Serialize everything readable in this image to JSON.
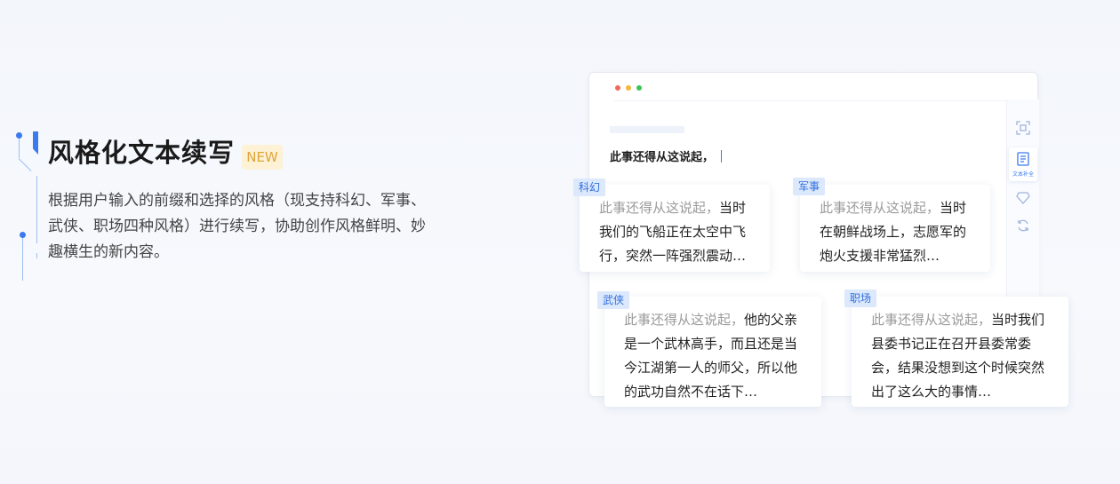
{
  "feature": {
    "title": "风格化文本续写",
    "badge": "NEW",
    "description": "根据用户输入的前缀和选择的风格（现支持科幻、军事、武侠、职场四种风格）进行续写，协助创作风格鲜明、妙趣横生的新内容。"
  },
  "colors": {
    "accent": "#3a7af0",
    "badge_bg": "#fdf1d6",
    "badge_text": "#e0a53a",
    "tag_bg": "#dce8fb"
  },
  "editor": {
    "prompt": "此事还得从这说起，",
    "tools": [
      {
        "icon": "scan-icon"
      },
      {
        "icon": "document-icon",
        "label": "文本补全"
      },
      {
        "icon": "diamond-icon"
      },
      {
        "icon": "refresh-icon"
      }
    ]
  },
  "styles": [
    {
      "tag": "科幻",
      "prefix": "此事还得从这说起，",
      "continuation": "当时我们的飞船正在太空中飞行，突然一阵强烈震动…"
    },
    {
      "tag": "军事",
      "prefix": "此事还得从这说起，",
      "continuation": "当时在朝鲜战场上，志愿军的炮火支援非常猛烈…"
    },
    {
      "tag": "武侠",
      "prefix": "此事还得从这说起，",
      "continuation": "他的父亲是一个武林高手，而且还是当今江湖第一人的师父，所以他的武功自然不在话下…"
    },
    {
      "tag": "职场",
      "prefix": "此事还得从这说起，",
      "continuation": "当时我们县委书记正在召开县委常委会，结果没想到这个时候突然出了这么大的事情…"
    }
  ]
}
